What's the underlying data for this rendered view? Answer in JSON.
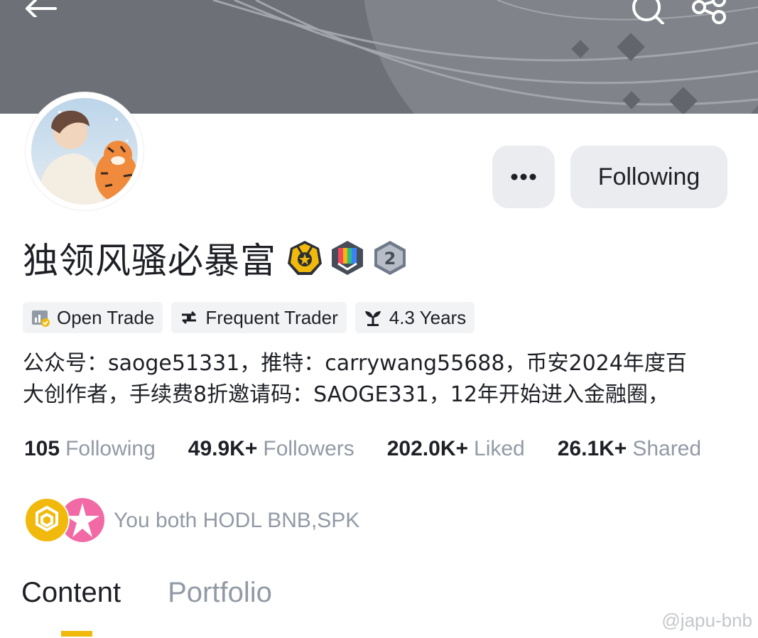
{
  "header": {
    "back_icon": "arrow-left-icon",
    "search_icon": "search-icon",
    "share_icon": "share-icon"
  },
  "profile": {
    "avatar": "avatar",
    "name": "独领风骚必暴富",
    "badges": [
      "medal-badge-icon",
      "colorful-badge-icon",
      "level-2-badge-icon"
    ],
    "more_label": "•••",
    "follow_label": "Following"
  },
  "tags": [
    {
      "icon": "open-trade-icon",
      "label": "Open Trade"
    },
    {
      "icon": "frequent-trader-icon",
      "label": "Frequent Trader"
    },
    {
      "icon": "sprout-icon",
      "label": "4.3 Years"
    }
  ],
  "bio": {
    "line1": "公众号：saoge51331，推特：carrywang55688，币安2024年度百",
    "line2": "大创作者，手续费8折邀请码：SAOGE331，12年开始进入金融圈，"
  },
  "stats": [
    {
      "value": "105",
      "label": "Following"
    },
    {
      "value": "49.9K+",
      "label": "Followers"
    },
    {
      "value": "202.0K+",
      "label": "Liked"
    },
    {
      "value": "26.1K+",
      "label": "Shared"
    }
  ],
  "hodl": {
    "coins": [
      "BNB",
      "SPK"
    ],
    "text": "You both HODL BNB,SPK"
  },
  "tabs": [
    {
      "label": "Content",
      "active": true
    },
    {
      "label": "Portfolio",
      "active": false
    }
  ],
  "watermark": "@japu-bnb",
  "colors": {
    "accent": "#F0B90B",
    "banner": "#6D7177",
    "muted_text": "#929AA5",
    "button_bg": "#EAECEF"
  }
}
